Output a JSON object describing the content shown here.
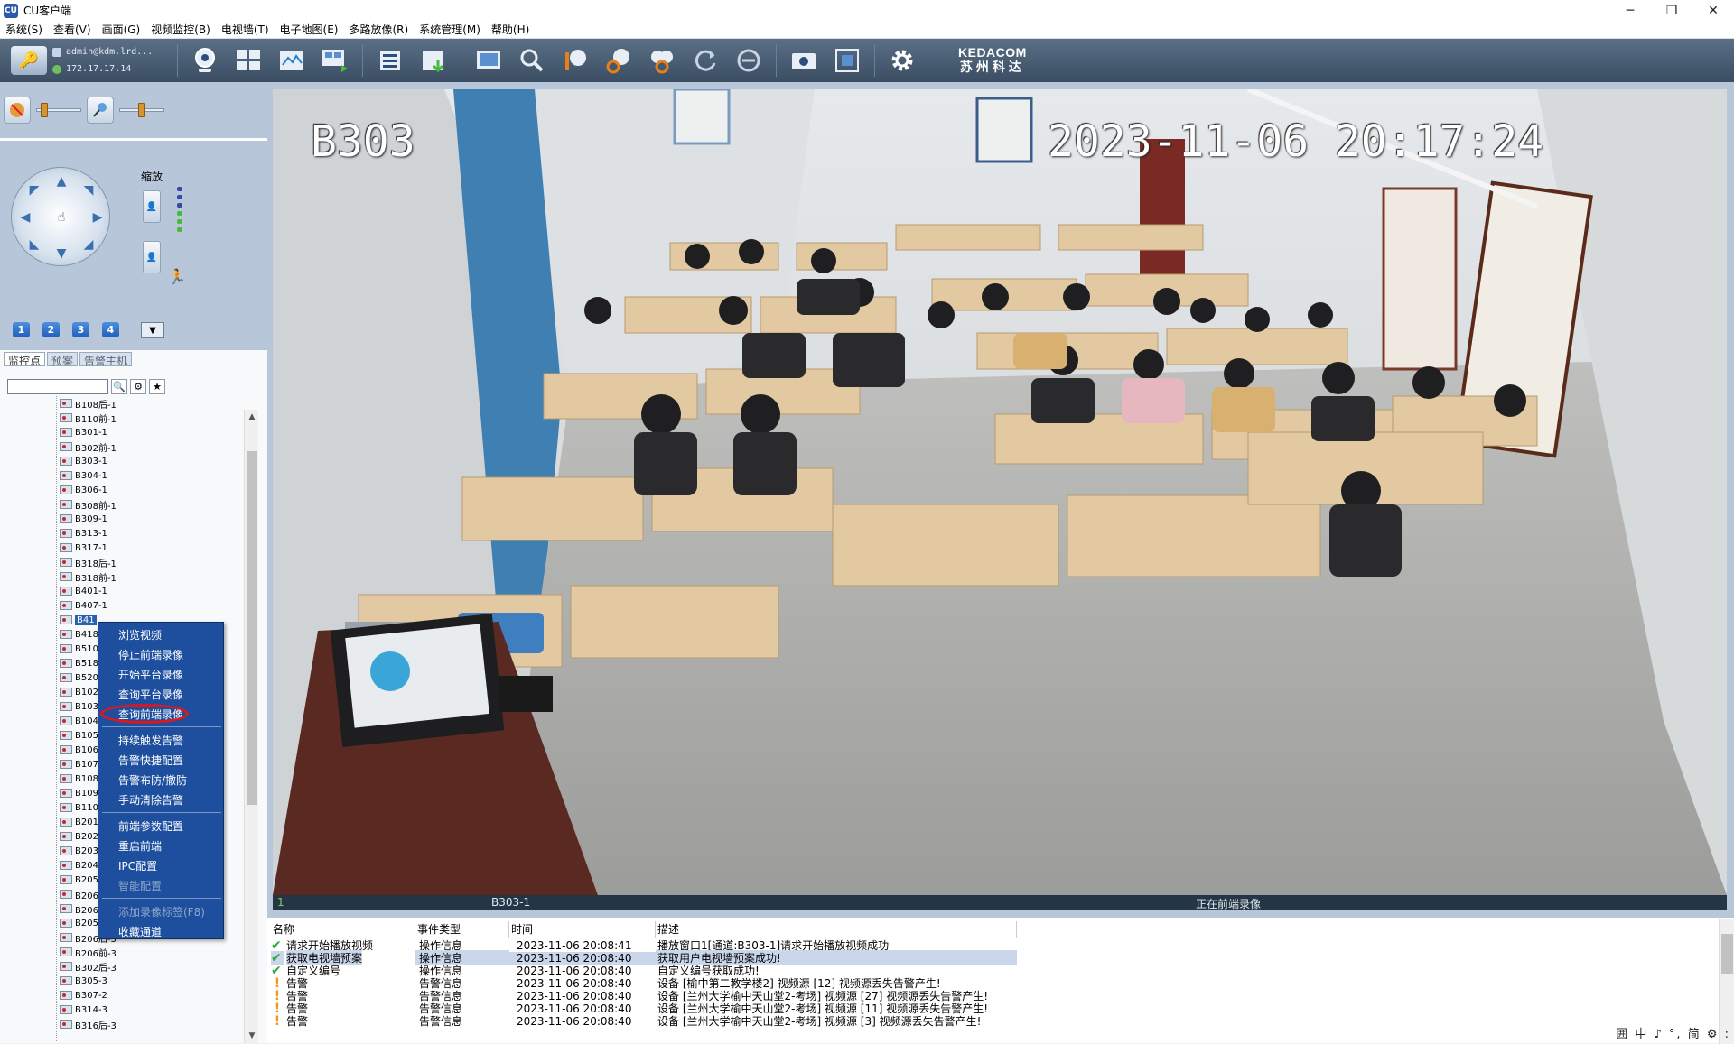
{
  "window": {
    "title": "CU客户端",
    "minimize": "─",
    "maximize": "❐",
    "close": "✕"
  },
  "menu": [
    "系统(S)",
    "查看(V)",
    "画面(G)",
    "视频监控(B)",
    "电视墙(T)",
    "电子地图(E)",
    "多路放像(R)",
    "系统管理(M)",
    "帮助(H)"
  ],
  "toolbar": {
    "user": "admin@kdm.lrd...",
    "ip": "172.17.17.14",
    "brand_en": "KEDACOM",
    "brand_cn": "苏州科达"
  },
  "ptz": {
    "zoom_label": "缩放",
    "presets": [
      "1",
      "2",
      "3",
      "4"
    ]
  },
  "tabs": [
    "监控点",
    "预案",
    "告警主机"
  ],
  "tree": [
    "B108后-1",
    "B110前-1",
    "B301-1",
    "B302前-1",
    "B303-1",
    "B304-1",
    "B306-1",
    "B308前-1",
    "B309-1",
    "B313-1",
    "B317-1",
    "B318后-1",
    "B318前-1",
    "B401-1",
    "B407-1",
    "B41",
    "B418",
    "B510",
    "B518",
    "B520",
    "B102",
    "B103",
    "B104",
    "B105",
    "B106",
    "B107",
    "B108",
    "B109",
    "B110",
    "B201",
    "B202",
    "B203",
    "B204",
    "B205",
    "B206后-1",
    "B206前-1",
    "B205-3",
    "B206后-3",
    "B206前-3",
    "B302后-3",
    "B305-3",
    "B307-2",
    "B314-3",
    "B316后-3"
  ],
  "context_menu": [
    {
      "label": "浏览视频",
      "enabled": true
    },
    {
      "label": "停止前端录像",
      "enabled": true
    },
    {
      "label": "开始平台录像",
      "enabled": true
    },
    {
      "label": "查询平台录像",
      "enabled": true
    },
    {
      "label": "查询前端录像",
      "enabled": true
    },
    {
      "sep": true
    },
    {
      "label": "持续触发告警",
      "enabled": true
    },
    {
      "label": "告警快捷配置",
      "enabled": true
    },
    {
      "label": "告警布防/撤防",
      "enabled": true
    },
    {
      "label": "手动清除告警",
      "enabled": true
    },
    {
      "sep": true
    },
    {
      "label": "前端参数配置",
      "enabled": true
    },
    {
      "label": "重启前端",
      "enabled": true
    },
    {
      "label": "IPC配置",
      "enabled": true
    },
    {
      "label": "智能配置",
      "enabled": false
    },
    {
      "sep": true
    },
    {
      "label": "添加录像标签(F8)",
      "enabled": false
    },
    {
      "label": "收藏通道",
      "enabled": true
    }
  ],
  "video": {
    "osd_name": "B303",
    "osd_datetime": "2023-11-06  20:17:24",
    "window_index": "1",
    "channel_name": "B303-1",
    "status_text": "正在前端录像"
  },
  "log": {
    "headers": [
      "名称",
      "事件类型",
      "时间",
      "描述"
    ],
    "rows": [
      {
        "icon": "ok",
        "name": "请求开始播放视频",
        "type": "操作信息",
        "time": "2023-11-06 20:08:41",
        "desc": "播放窗口1[通道:B303-1]请求开始播放视频成功"
      },
      {
        "icon": "ok",
        "name": "获取电视墙预案",
        "type": "操作信息",
        "time": "2023-11-06 20:08:40",
        "desc": "获取用户电视墙预案成功!",
        "highlight": true
      },
      {
        "icon": "ok",
        "name": "自定义编号",
        "type": "操作信息",
        "time": "2023-11-06 20:08:40",
        "desc": "自定义编号获取成功!"
      },
      {
        "icon": "warn",
        "name": "告警",
        "type": "告警信息",
        "time": "2023-11-06 20:08:40",
        "desc": "设备 [榆中第二教学楼2] 视频源 [12] 视频源丢失告警产生!"
      },
      {
        "icon": "warn",
        "name": "告警",
        "type": "告警信息",
        "time": "2023-11-06 20:08:40",
        "desc": "设备 [兰州大学榆中天山堂2-考场] 视频源 [27] 视频源丢失告警产生!"
      },
      {
        "icon": "warn",
        "name": "告警",
        "type": "告警信息",
        "time": "2023-11-06 20:08:40",
        "desc": "设备 [兰州大学榆中天山堂2-考场] 视频源 [11] 视频源丢失告警产生!"
      },
      {
        "icon": "warn",
        "name": "告警",
        "type": "告警信息",
        "time": "2023-11-06 20:08:40",
        "desc": "设备 [兰州大学榆中天山堂2-考场] 视频源 [3] 视频源丢失告警产生!"
      }
    ]
  },
  "ime": "囲 中 ♪ °, 简 ⚙ :"
}
